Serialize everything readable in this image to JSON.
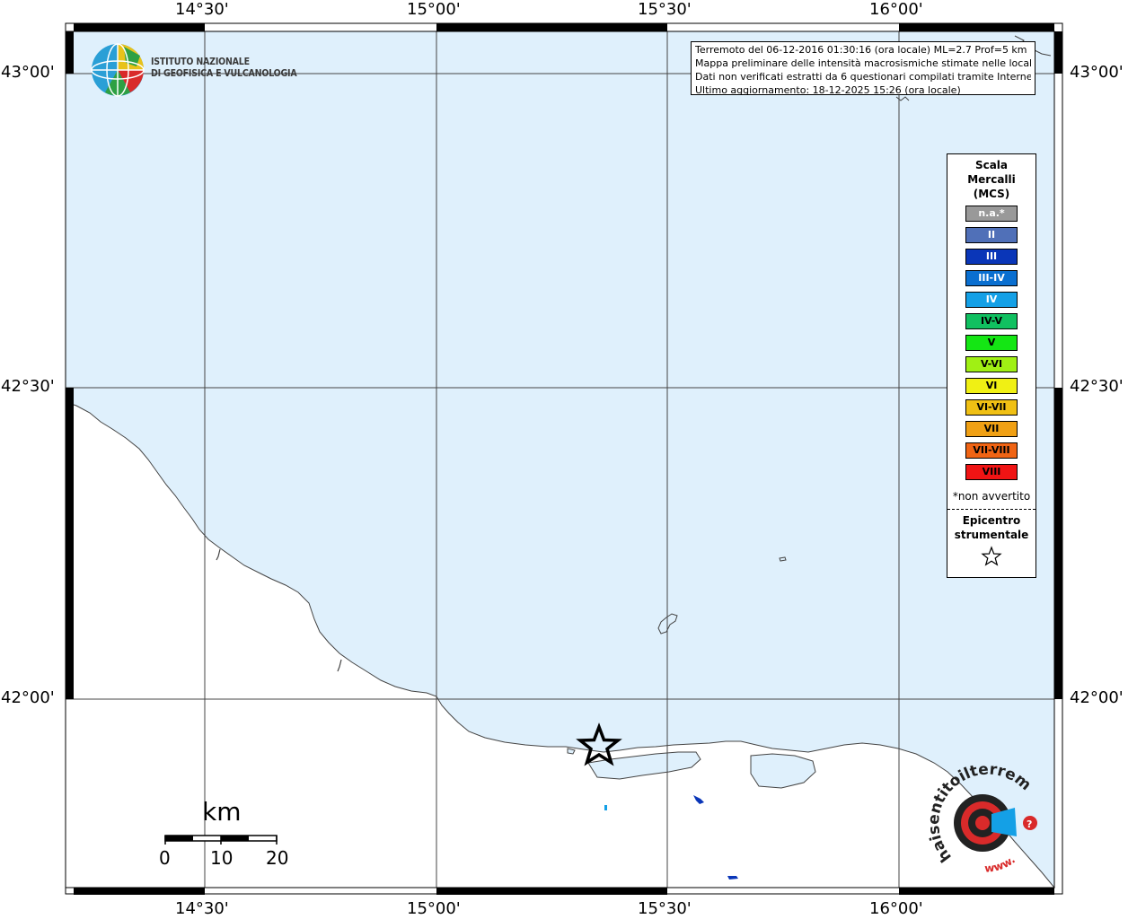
{
  "info": {
    "lines": [
      "Terremoto del 06-12-2016 01:30:16 (ora locale) ML=2.7 Prof=5 km",
      "Mappa preliminare delle intensità macrosismiche stimate nelle località",
      "Dati non verificati estratti da 6 questionari compilati tramite Internet.",
      "Ultimo aggiornamento: 18-12-2025 15:26 (ora locale)"
    ]
  },
  "logo": {
    "line1": "ISTITUTO NAZIONALE",
    "line2": "DI GEOFISICA E VULCANOLOGIA",
    "icon": "ingv-globe-logo"
  },
  "axes": {
    "top": [
      "14°30'",
      "15°00'",
      "15°30'",
      "16°00'"
    ],
    "bottom": [
      "14°30'",
      "15°00'",
      "15°30'",
      "16°00'"
    ],
    "left": [
      "43°00'",
      "42°30'",
      "42°00'"
    ],
    "right": [
      "43°00'",
      "42°30'",
      "42°00'"
    ]
  },
  "legend": {
    "title": [
      "Scala",
      "Mercalli",
      "(MCS)"
    ],
    "items": [
      {
        "label": "n.a.*",
        "color": "#999999",
        "text": "#ffffff"
      },
      {
        "label": "II",
        "color": "#5070b8",
        "text": "#ffffff"
      },
      {
        "label": "III",
        "color": "#0a36b8",
        "text": "#ffffff"
      },
      {
        "label": "III-IV",
        "color": "#0a6fd0",
        "text": "#ffffff"
      },
      {
        "label": "IV",
        "color": "#14a0e6",
        "text": "#ffffff"
      },
      {
        "label": "IV-V",
        "color": "#10c060",
        "text": "#000000"
      },
      {
        "label": "V",
        "color": "#14e614",
        "text": "#000000"
      },
      {
        "label": "V-VI",
        "color": "#a0f014",
        "text": "#000000"
      },
      {
        "label": "VI",
        "color": "#f0f014",
        "text": "#000000"
      },
      {
        "label": "VI-VII",
        "color": "#f0c014",
        "text": "#000000"
      },
      {
        "label": "VII",
        "color": "#f0a014",
        "text": "#000000"
      },
      {
        "label": "VII-VIII",
        "color": "#f06414",
        "text": "#000000"
      },
      {
        "label": "VIII",
        "color": "#f01414",
        "text": "#000000"
      }
    ],
    "note": "*non avvertito",
    "epicenter": [
      "Epicentro",
      "strumentale"
    ],
    "epicenter_icon": "star-icon"
  },
  "scalebar": {
    "unit": "km",
    "labels": [
      "0",
      "10",
      "20"
    ]
  },
  "badge": {
    "text": "haisentitoilterremoto.it",
    "url": "www.",
    "icon": "haisentito-logo"
  },
  "colors": {
    "sea": "#dff0fc",
    "land": "#ffffff"
  }
}
